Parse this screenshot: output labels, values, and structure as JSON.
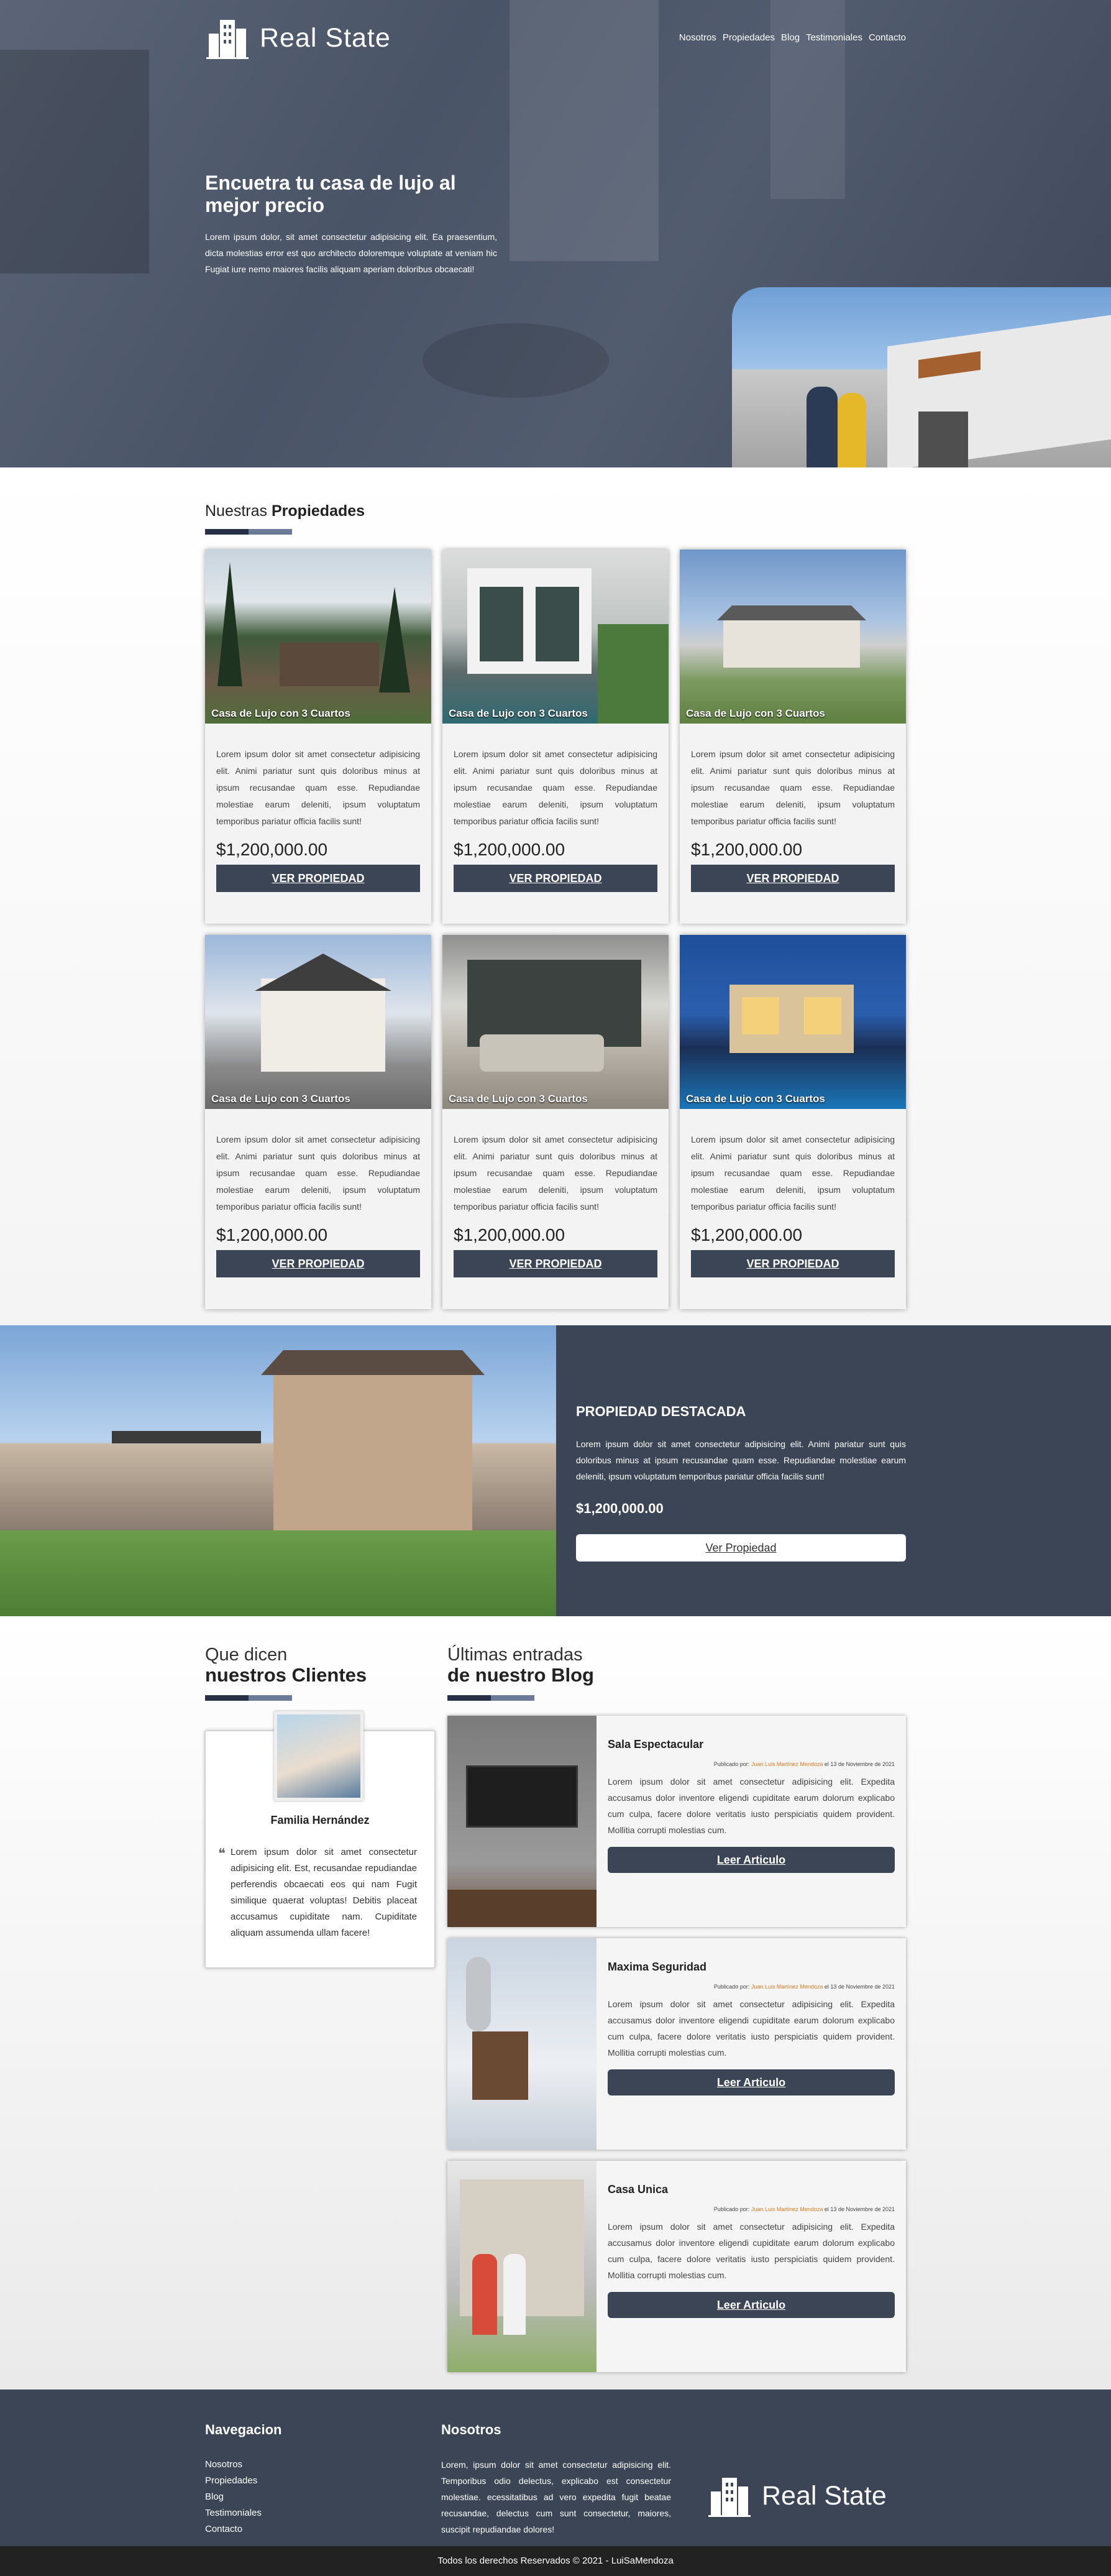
{
  "header": {
    "logo_text": "Real State",
    "nav": [
      "Nosotros",
      "Propiedades",
      "Blog",
      "Testimoniales",
      "Contacto"
    ]
  },
  "hero": {
    "title": "Encuetra tu casa de lujo al mejor precio",
    "text": "Lorem ipsum dolor, sit amet consectetur adipisicing elit. Ea praesentium, dicta molestias error est quo architecto doloremque voluptate at veniam hic Fugiat iure nemo maiores facilis aliquam aperiam doloribus obcaecati!"
  },
  "properties": {
    "title_light": "Nuestras",
    "title_bold": "Propiedades",
    "items": [
      {
        "caption": "Casa de Lujo con 3 Cuartos",
        "text": "Lorem ipsum dolor sit amet consectetur adipisicing elit. Animi pariatur sunt quis doloribus minus at ipsum recusandae quam esse. Repudiandae molestiae earum deleniti, ipsum voluptatum temporibus pariatur officia facilis sunt!",
        "price": "$1,200,000.00",
        "button": "VER PROPIEDAD"
      },
      {
        "caption": "Casa de Lujo con 3 Cuartos",
        "text": "Lorem ipsum dolor sit amet consectetur adipisicing elit. Animi pariatur sunt quis doloribus minus at ipsum recusandae quam esse. Repudiandae molestiae earum deleniti, ipsum voluptatum temporibus pariatur officia facilis sunt!",
        "price": "$1,200,000.00",
        "button": "VER PROPIEDAD"
      },
      {
        "caption": "Casa de Lujo con 3 Cuartos",
        "text": "Lorem ipsum dolor sit amet consectetur adipisicing elit. Animi pariatur sunt quis doloribus minus at ipsum recusandae quam esse. Repudiandae molestiae earum deleniti, ipsum voluptatum temporibus pariatur officia facilis sunt!",
        "price": "$1,200,000.00",
        "button": "VER PROPIEDAD"
      },
      {
        "caption": "Casa de Lujo con 3 Cuartos",
        "text": "Lorem ipsum dolor sit amet consectetur adipisicing elit. Animi pariatur sunt quis doloribus minus at ipsum recusandae quam esse. Repudiandae molestiae earum deleniti, ipsum voluptatum temporibus pariatur officia facilis sunt!",
        "price": "$1,200,000.00",
        "button": "VER PROPIEDAD"
      },
      {
        "caption": "Casa de Lujo con 3 Cuartos",
        "text": "Lorem ipsum dolor sit amet consectetur adipisicing elit. Animi pariatur sunt quis doloribus minus at ipsum recusandae quam esse. Repudiandae molestiae earum deleniti, ipsum voluptatum temporibus pariatur officia facilis sunt!",
        "price": "$1,200,000.00",
        "button": "VER PROPIEDAD"
      },
      {
        "caption": "Casa de Lujo con 3 Cuartos",
        "text": "Lorem ipsum dolor sit amet consectetur adipisicing elit. Animi pariatur sunt quis doloribus minus at ipsum recusandae quam esse. Repudiandae molestiae earum deleniti, ipsum voluptatum temporibus pariatur officia facilis sunt!",
        "price": "$1,200,000.00",
        "button": "VER PROPIEDAD"
      }
    ]
  },
  "featured": {
    "title": "PROPIEDAD DESTACADA",
    "text": "Lorem ipsum dolor sit amet consectetur adipisicing elit. Animi pariatur sunt quis doloribus minus at ipsum recusandae quam esse. Repudiandae molestiae earum deleniti, ipsum voluptatum temporibus pariatur officia facilis sunt!",
    "price": "$1,200,000.00",
    "button": "Ver Propiedad"
  },
  "testimonials": {
    "sub": "Que dicen",
    "main": "nuestros Clientes",
    "name": "Familia Hernández",
    "text": "Lorem ipsum dolor sit amet consectetur adipisicing elit. Est, recusandae repudiandae perferendis obcaecati eos qui nam Fugit similique quaerat voluptas! Debitis placeat accusamus cupiditate nam. Cupiditate aliquam assumenda ullam facere!"
  },
  "blog": {
    "sub": "Últimas entradas",
    "main": "de nuestro Blog",
    "posts": [
      {
        "title": "Sala Espectacular",
        "meta_prefix": "Publicado por:",
        "author": "Juan Luis Martínez Mendoza",
        "date": "el 13 de Noviembre de 2021",
        "text": "Lorem ipsum dolor sit amet consectetur adipisicing elit. Expedita accusamus dolor inventore eligendi cupiditate earum dolorum explicabo cum culpa, facere dolore veritatis iusto perspiciatis quidem provident. Mollitia corrupti molestias cum.",
        "button": "Leer Articulo"
      },
      {
        "title": "Maxima Seguridad",
        "meta_prefix": "Publicado por:",
        "author": "Juan Luis Martínez Mendoza",
        "date": "el 13 de Noviembre de 2021",
        "text": "Lorem ipsum dolor sit amet consectetur adipisicing elit. Expedita accusamus dolor inventore eligendi cupiditate earum dolorum explicabo cum culpa, facere dolore veritatis iusto perspiciatis quidem provident. Mollitia corrupti molestias cum.",
        "button": "Leer Articulo"
      },
      {
        "title": "Casa Unica",
        "meta_prefix": "Publicado por:",
        "author": "Juan Luis Martínez Mendoza",
        "date": "el 13 de Noviembre de 2021",
        "text": "Lorem ipsum dolor sit amet consectetur adipisicing elit. Expedita accusamus dolor inventore eligendi cupiditate earum dolorum explicabo cum culpa, facere dolore veritatis iusto perspiciatis quidem provident. Mollitia corrupti molestias cum.",
        "button": "Leer Articulo"
      }
    ]
  },
  "footer": {
    "nav_title": "Navegacion",
    "nav": [
      "Nosotros",
      "Propiedades",
      "Blog",
      "Testimoniales",
      "Contacto"
    ],
    "about_title": "Nosotros",
    "about_text": "Lorem, ipsum dolor sit amet consectetur adipisicing elit. Temporibus odio delectus, explicabo est consectetur molestiae. ecessitatibus ad vero expedita fugit beatae recusandae, delectus cum sunt consectetur, maiores, suscipit repudiandae dolores!",
    "logo_text": "Real State",
    "copyright": "Todos los derechos Reservados © 2021 - LuiSaMendoza"
  },
  "colors": {
    "primary": "#3b4556",
    "accent_dark": "#273046",
    "accent_light": "#6b7a99",
    "author": "#e07b22"
  },
  "icons": {
    "logo": "building-logo-icon",
    "quote": "quote-icon"
  }
}
